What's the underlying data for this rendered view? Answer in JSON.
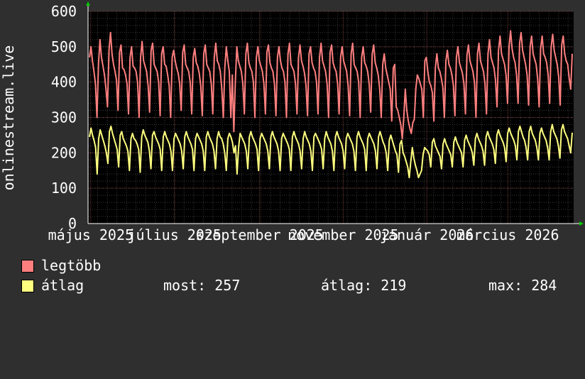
{
  "chart_data": {
    "type": "line",
    "ylabel": "onlinestream.live",
    "ylim": [
      0,
      600
    ],
    "yticks": [
      "0",
      "100",
      "200",
      "300",
      "400",
      "500",
      "600"
    ],
    "x_range": [
      "2025-04-29",
      "2026-04-18"
    ],
    "xticks": [
      {
        "label": "május 2025",
        "date": "2025-05-01"
      },
      {
        "label": "július 2025",
        "date": "2025-07-01"
      },
      {
        "label": "szeptember 2025",
        "date": "2025-09-01"
      },
      {
        "label": "november 2025",
        "date": "2025-11-01"
      },
      {
        "label": "január 2026",
        "date": "2026-01-01"
      },
      {
        "label": "március 2026",
        "date": "2026-03-01"
      }
    ],
    "grid": true,
    "colors": {
      "background": "#2f2f2f",
      "plot_bg": "#000000",
      "grid_major": "#6e3a3a",
      "grid_minor": "#3a3a3a",
      "legtobb": "#ff7f7f",
      "atlag": "#ffff7f",
      "axis_arrow": "#00cc00"
    },
    "series": [
      {
        "name": "legtöbb",
        "color": "#ff7f7f",
        "weekly_pattern": [
          500,
          445,
          440,
          432,
          395,
          300,
          470
        ],
        "values": [
          470,
          500,
          460,
          430,
          395,
          300,
          450,
          520,
          470,
          445,
          420,
          380,
          330,
          490,
          540,
          480,
          450,
          430,
          405,
          320,
          485,
          505,
          440,
          435,
          420,
          395,
          310,
          470,
          500,
          445,
          440,
          430,
          400,
          300,
          470,
          515,
          460,
          445,
          430,
          390,
          315,
          490,
          510,
          450,
          440,
          430,
          400,
          305,
          480,
          500,
          450,
          445,
          420,
          390,
          300,
          470,
          490,
          460,
          440,
          425,
          395,
          320,
          485,
          505,
          450,
          440,
          430,
          400,
          310,
          470,
          495,
          455,
          445,
          425,
          390,
          305,
          480,
          505,
          450,
          440,
          430,
          395,
          310,
          470,
          510,
          460,
          450,
          430,
          380,
          300,
          440,
          500,
          460,
          430,
          300,
          420,
          260,
          400,
          500,
          460,
          445,
          430,
          395,
          310,
          480,
          510,
          455,
          440,
          430,
          400,
          300,
          470,
          500,
          460,
          445,
          430,
          395,
          310,
          485,
          505,
          455,
          440,
          430,
          395,
          305,
          470,
          500,
          460,
          440,
          430,
          400,
          300,
          480,
          510,
          450,
          440,
          430,
          395,
          310,
          470,
          505,
          460,
          445,
          425,
          390,
          305,
          480,
          500,
          455,
          440,
          430,
          400,
          310,
          470,
          510,
          460,
          445,
          430,
          395,
          300,
          485,
          505,
          455,
          440,
          430,
          395,
          310,
          470,
          500,
          460,
          445,
          430,
          390,
          305,
          480,
          510,
          450,
          440,
          430,
          400,
          300,
          470,
          500,
          455,
          445,
          430,
          395,
          315,
          480,
          505,
          455,
          440,
          420,
          380,
          300,
          450,
          480,
          440,
          420,
          400,
          380,
          290,
          440,
          450,
          330,
          320,
          300,
          280,
          240,
          300,
          380,
          320,
          290,
          270,
          255,
          285,
          295,
          380,
          420,
          410,
          395,
          380,
          300,
          460,
          470,
          430,
          400,
          390,
          370,
          290,
          440,
          480,
          440,
          430,
          410,
          385,
          300,
          460,
          490,
          450,
          440,
          420,
          390,
          305,
          470,
          500,
          455,
          440,
          425,
          395,
          310,
          475,
          505,
          460,
          445,
          430,
          400,
          300,
          480,
          510,
          460,
          445,
          430,
          395,
          310,
          480,
          520,
          470,
          455,
          440,
          405,
          330,
          490,
          530,
          480,
          465,
          450,
          420,
          340,
          500,
          545,
          495,
          470,
          455,
          420,
          340,
          510,
          540,
          490,
          470,
          450,
          420,
          335,
          500,
          530,
          480,
          465,
          450,
          410,
          330,
          495,
          530,
          480,
          470,
          455,
          420,
          340,
          500,
          535,
          490,
          470,
          450,
          415,
          335,
          505,
          530,
          480,
          460,
          450,
          410,
          380,
          480
        ]
      },
      {
        "name": "átlag",
        "color": "#ffff7f",
        "values": [
          245,
          270,
          250,
          235,
          215,
          140,
          240,
          265,
          250,
          235,
          220,
          200,
          170,
          260,
          275,
          255,
          240,
          225,
          210,
          160,
          250,
          260,
          240,
          230,
          220,
          205,
          150,
          240,
          255,
          240,
          235,
          225,
          210,
          145,
          245,
          265,
          250,
          240,
          230,
          205,
          155,
          250,
          260,
          245,
          235,
          225,
          210,
          150,
          245,
          260,
          245,
          235,
          225,
          205,
          150,
          240,
          255,
          245,
          235,
          225,
          205,
          155,
          245,
          260,
          245,
          235,
          225,
          210,
          150,
          240,
          255,
          245,
          235,
          225,
          205,
          150,
          245,
          260,
          245,
          235,
          225,
          205,
          155,
          240,
          260,
          245,
          240,
          225,
          200,
          150,
          240,
          255,
          245,
          230,
          200,
          220,
          140,
          215,
          255,
          245,
          235,
          225,
          205,
          155,
          245,
          260,
          245,
          235,
          225,
          210,
          150,
          240,
          255,
          245,
          235,
          225,
          205,
          155,
          245,
          260,
          245,
          235,
          225,
          205,
          150,
          240,
          255,
          245,
          235,
          225,
          210,
          150,
          245,
          260,
          245,
          235,
          225,
          205,
          155,
          240,
          260,
          245,
          235,
          225,
          205,
          150,
          245,
          255,
          245,
          235,
          225,
          210,
          155,
          240,
          260,
          245,
          235,
          225,
          205,
          150,
          245,
          260,
          245,
          235,
          225,
          205,
          155,
          240,
          255,
          245,
          235,
          225,
          205,
          150,
          245,
          260,
          245,
          235,
          225,
          210,
          150,
          240,
          255,
          245,
          235,
          225,
          205,
          155,
          245,
          260,
          245,
          230,
          220,
          200,
          150,
          235,
          250,
          235,
          220,
          205,
          195,
          145,
          225,
          235,
          200,
          190,
          175,
          160,
          130,
          175,
          215,
          185,
          165,
          150,
          130,
          140,
          150,
          195,
          215,
          210,
          205,
          195,
          160,
          230,
          240,
          220,
          210,
          200,
          190,
          155,
          225,
          240,
          225,
          215,
          205,
          195,
          160,
          230,
          245,
          230,
          220,
          210,
          200,
          160,
          235,
          250,
          235,
          225,
          215,
          200,
          165,
          240,
          255,
          240,
          230,
          220,
          205,
          165,
          245,
          260,
          245,
          235,
          225,
          210,
          170,
          250,
          265,
          250,
          240,
          230,
          215,
          175,
          255,
          270,
          255,
          245,
          235,
          220,
          180,
          260,
          275,
          260,
          245,
          235,
          215,
          180,
          260,
          275,
          255,
          245,
          235,
          215,
          180,
          255,
          270,
          255,
          245,
          235,
          215,
          180,
          260,
          280,
          260,
          250,
          240,
          220,
          185,
          265,
          280,
          260,
          250,
          240,
          220,
          200,
          257
        ]
      }
    ]
  },
  "legend": {
    "items": [
      {
        "name": "legtöbb",
        "color": "#ff7f7f"
      },
      {
        "name": "átlag",
        "color": "#ffff7f"
      }
    ],
    "stats": {
      "most": "most: 257",
      "atlag": "átlag: 219",
      "max": "max: 284"
    }
  }
}
